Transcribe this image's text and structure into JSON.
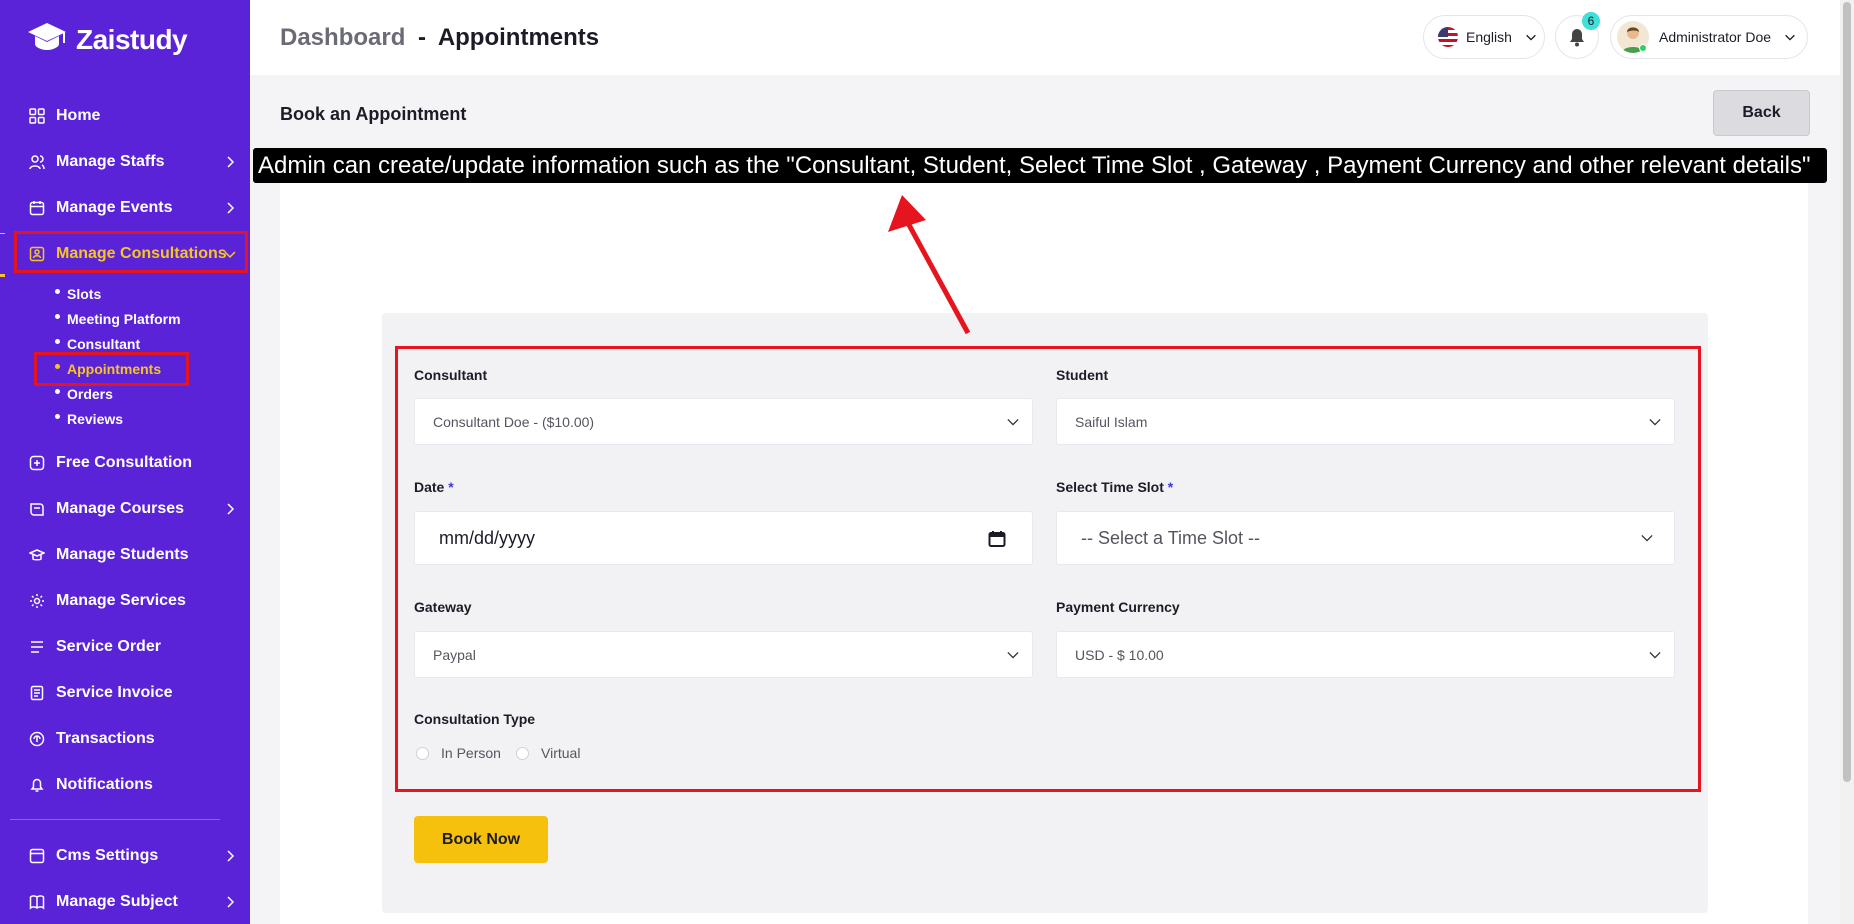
{
  "app": {
    "name": "Zaistudy"
  },
  "sidebar": {
    "items": [
      {
        "label": "Home",
        "icon": "grid-icon"
      },
      {
        "label": "Manage Staffs",
        "icon": "users-icon"
      },
      {
        "label": "Manage Events",
        "icon": "calendar-icon"
      },
      {
        "label": "Manage Consultations",
        "icon": "consult-icon"
      },
      {
        "label": "Free Consultation",
        "icon": "free-consult-icon"
      },
      {
        "label": "Manage Courses",
        "icon": "courses-icon"
      },
      {
        "label": "Manage Students",
        "icon": "students-icon"
      },
      {
        "label": "Manage Services",
        "icon": "services-icon"
      },
      {
        "label": "Service Order",
        "icon": "order-icon"
      },
      {
        "label": "Service Invoice",
        "icon": "invoice-icon"
      },
      {
        "label": "Transactions",
        "icon": "transactions-icon"
      },
      {
        "label": "Notifications",
        "icon": "bell-icon"
      },
      {
        "label": "Cms Settings",
        "icon": "cms-icon"
      },
      {
        "label": "Manage Subject",
        "icon": "book-icon"
      }
    ],
    "submenu": [
      {
        "label": "Slots"
      },
      {
        "label": "Meeting Platform"
      },
      {
        "label": "Consultant"
      },
      {
        "label": "Appointments"
      },
      {
        "label": "Orders"
      },
      {
        "label": "Reviews"
      }
    ]
  },
  "header": {
    "breadcrumb_root": "Dashboard",
    "breadcrumb_sep": "-",
    "breadcrumb_current": "Appointments",
    "language": "English",
    "notification_count": "6",
    "user_name": "Administrator Doe"
  },
  "page": {
    "title": "Book an Appointment",
    "back_label": "Back"
  },
  "form": {
    "consultant_label": "Consultant",
    "consultant_value": "Consultant Doe - ($10.00)",
    "student_label": "Student",
    "student_value": "Saiful Islam",
    "date_label": "Date",
    "date_placeholder": "mm/dd/yyyy",
    "timeslot_label": "Select Time Slot",
    "timeslot_value": "-- Select a Time Slot --",
    "required_mark": "*",
    "gateway_label": "Gateway",
    "gateway_value": "Paypal",
    "currency_label": "Payment Currency",
    "currency_value": "USD - $ 10.00",
    "consultation_type_label": "Consultation Type",
    "type_options": [
      "In Person",
      "Virtual"
    ],
    "submit_label": "Book Now"
  },
  "annotation": {
    "text": "Admin can create/update information such as the \"Consultant, Student, Select Time Slot , Gateway , Payment Currency and other relevant details\""
  },
  "colors": {
    "sidebar_bg": "#5a23d8",
    "accent": "#f7c523",
    "highlight_box": "#e5141e"
  }
}
